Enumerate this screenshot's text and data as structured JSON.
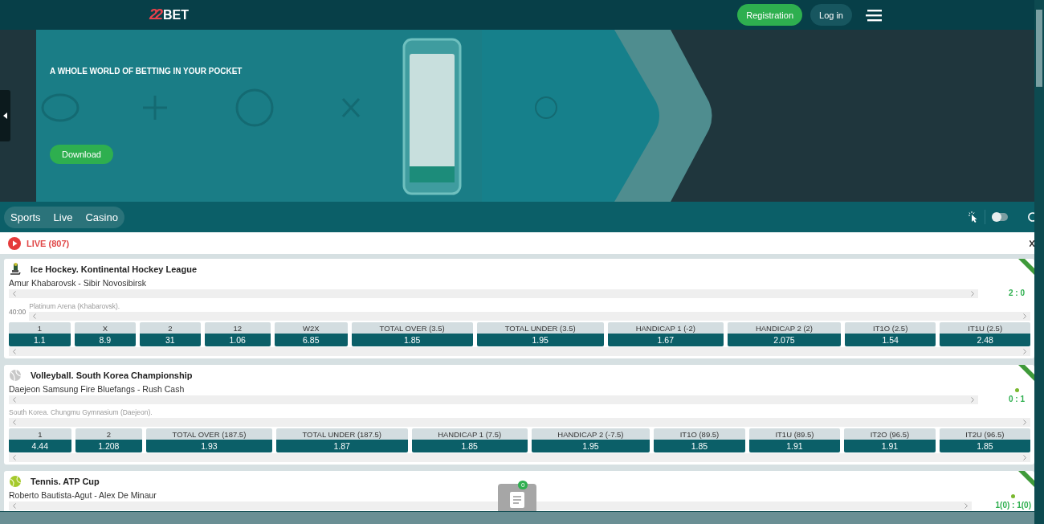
{
  "header": {
    "logo": {
      "mark": "22",
      "text": "BET"
    },
    "buttons": [
      {
        "label": "Registration",
        "kind": "primary"
      },
      {
        "label": "Log in",
        "kind": "secondary"
      }
    ]
  },
  "banner": {
    "headline": "A WHOLE WORLD OF BETTING IN YOUR POCKET",
    "button": "Download"
  },
  "nav": {
    "tabs": [
      "Sports",
      "Live",
      "Casino"
    ],
    "toggle": {
      "on": false
    }
  },
  "live": {
    "label": "LIVE (807)"
  },
  "events": [
    {
      "kind": "hockey",
      "title": "Ice Hockey. Kontinental Hockey League",
      "teams": "Amur Khabarovsk - Sibir Novosibirsk",
      "time": "40:00",
      "venue": "Platinum Arena (Khabarovsk).",
      "score": "2 : 0",
      "serving": false,
      "markets": [
        {
          "label": "1",
          "odd": "1.1"
        },
        {
          "label": "X",
          "odd": "8.9"
        },
        {
          "label": "2",
          "odd": "31"
        },
        {
          "label": "12",
          "odd": "1.06"
        },
        {
          "label": "W2X",
          "odd": "6.85"
        },
        {
          "label": "TOTAL OVER (3.5)",
          "odd": "1.85"
        },
        {
          "label": "TOTAL UNDER (3.5)",
          "odd": "1.95"
        },
        {
          "label": "HANDICAP 1 (-2)",
          "odd": "1.67"
        },
        {
          "label": "HANDICAP 2 (2)",
          "odd": "2.075"
        },
        {
          "label": "IT1O (2.5)",
          "odd": "1.54"
        },
        {
          "label": "IT1U (2.5)",
          "odd": "2.48"
        }
      ]
    },
    {
      "kind": "volleyball",
      "title": "Volleyball. South Korea Championship",
      "teams": "Daejeon Samsung Fire Bluefangs - Rush Cash",
      "venue": "South Korea. Chungmu Gymnasium (Daejeon).",
      "score": "0 : 1",
      "serving": true,
      "markets": [
        {
          "label": "1",
          "odd": "4.44"
        },
        {
          "label": "2",
          "odd": "1.208"
        },
        {
          "label": "TOTAL OVER (187.5)",
          "odd": "1.93"
        },
        {
          "label": "TOTAL UNDER (187.5)",
          "odd": "1.87"
        },
        {
          "label": "HANDICAP 1 (7.5)",
          "odd": "1.85"
        },
        {
          "label": "HANDICAP 2 (-7.5)",
          "odd": "1.95"
        },
        {
          "label": "IT1O (89.5)",
          "odd": "1.85"
        },
        {
          "label": "IT1U (89.5)",
          "odd": "1.91"
        },
        {
          "label": "IT2O (96.5)",
          "odd": "1.91"
        },
        {
          "label": "IT2U (96.5)",
          "odd": "1.85"
        }
      ]
    },
    {
      "kind": "tennis",
      "title": "Tennis. ATP Cup",
      "teams": "Roberto Bautista-Agut - Alex De Minaur",
      "score": "1(0) : 1(0)",
      "serving": true
    }
  ],
  "bet_slip": {
    "count": "0"
  }
}
